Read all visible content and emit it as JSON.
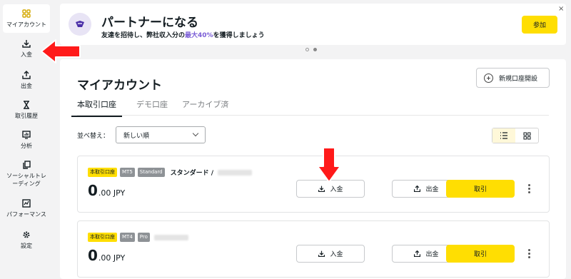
{
  "sidebar": {
    "items": [
      {
        "label": "マイアカウント",
        "icon": "grid-icon"
      },
      {
        "label": "入金",
        "icon": "download-icon"
      },
      {
        "label": "出金",
        "icon": "upload-icon"
      },
      {
        "label": "取引履歴",
        "icon": "hourglass-icon"
      },
      {
        "label": "分析",
        "icon": "chart-icon"
      },
      {
        "label": "ソーシャルトレーディング",
        "icon": "copy-icon"
      },
      {
        "label": "パフォーマンス",
        "icon": "performance-icon"
      },
      {
        "label": "設定",
        "icon": "gear-icon"
      }
    ]
  },
  "banner": {
    "title": "パートナーになる",
    "subtitle_prefix": "友達を招待し、弊社収入分の",
    "subtitle_highlight": "最大40%",
    "subtitle_suffix": "を獲得しましょう",
    "button": "参加",
    "close": "×"
  },
  "main": {
    "title": "マイアカウント",
    "new_account": "新規口座開設",
    "tabs": [
      {
        "label": "本取引口座",
        "active": true
      },
      {
        "label": "デモ口座",
        "active": false
      },
      {
        "label": "アーカイブ済",
        "active": false
      }
    ],
    "sort_label": "並べ替え：",
    "sort_value": "新しい順"
  },
  "accounts": [
    {
      "badges": [
        "本取引口座",
        "MT5",
        "Standard"
      ],
      "name": "スタンダード /",
      "balance_int": "0",
      "balance_dec": ".00 JPY",
      "deposit": "入金",
      "withdraw": "出金",
      "trade": "取引"
    },
    {
      "badges": [
        "本取引口座",
        "MT4",
        "Pro"
      ],
      "name": "",
      "balance_int": "0",
      "balance_dec": ".00 JPY",
      "deposit": "入金",
      "withdraw": "出金",
      "trade": "取引"
    }
  ],
  "colors": {
    "accent": "#ffde02",
    "highlight": "#7b5ed6",
    "annotation_arrow": "#ff1a1a"
  }
}
